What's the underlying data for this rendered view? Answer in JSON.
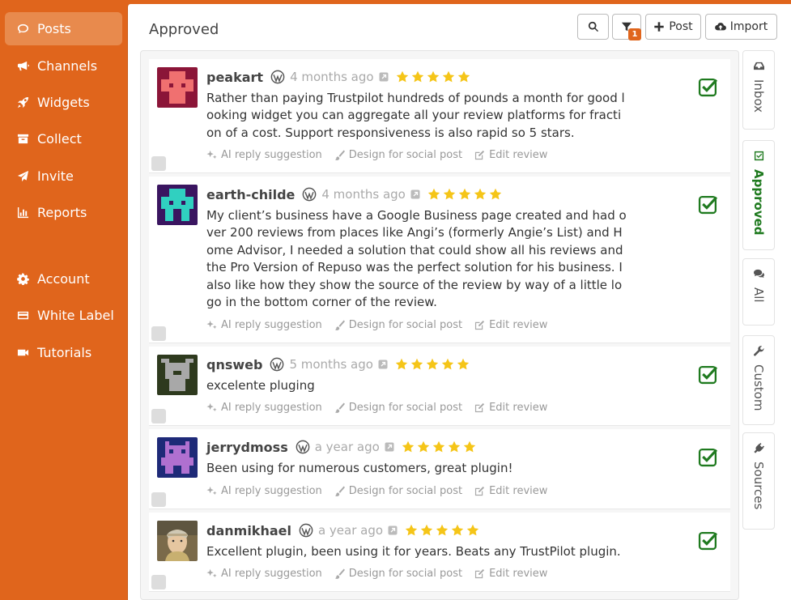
{
  "sidebar": {
    "items": [
      {
        "label": "Posts",
        "icon": "comment-icon",
        "active": true
      },
      {
        "label": "Channels",
        "icon": "megaphone-icon"
      },
      {
        "label": "Widgets",
        "icon": "rocket-icon"
      },
      {
        "label": "Collect",
        "icon": "archive-icon"
      },
      {
        "label": "Invite",
        "icon": "paper-plane-icon"
      },
      {
        "label": "Reports",
        "icon": "bar-chart-icon"
      },
      {
        "label": "Account",
        "icon": "gear-icon"
      },
      {
        "label": "White Label",
        "icon": "credit-card-icon"
      },
      {
        "label": "Tutorials",
        "icon": "video-icon"
      }
    ]
  },
  "header": {
    "title": "Approved",
    "filter_badge": "1",
    "post_label": "Post",
    "import_label": "Import"
  },
  "actions": {
    "ai": "AI reply suggestion",
    "design": "Design for social post",
    "edit": "Edit review"
  },
  "reviews": [
    {
      "author": "peakart",
      "time": "4 months ago",
      "rating": 5,
      "text": "Rather than paying Trustpilot hundreds of pounds a month for good looking widget you can aggregate all your review platforms for fraction of a cost. Support responsiveness is also rapid so 5 stars."
    },
    {
      "author": "earth-childe",
      "time": "4 months ago",
      "rating": 5,
      "text": "My client’s business have a Google Business page created and had over 200 reviews from places like Angi’s (formerly Angie’s List) and Home Advisor, I needed a solution that could show all his reviews and the Pro Version of Repuso was the perfect solution for his business. I also like how they show the source of the review by way of a little logo in the bottom corner of the review."
    },
    {
      "author": "qnsweb",
      "time": "5 months ago",
      "rating": 5,
      "text": "excelente pluging"
    },
    {
      "author": "jerrydmoss",
      "time": "a year ago",
      "rating": 5,
      "text": "Been using for numerous customers, great plugin!"
    },
    {
      "author": "danmikhael",
      "time": "a year ago",
      "rating": 5,
      "text": "Excellent plugin, been using it for years. Beats any TrustPilot plugin."
    }
  ],
  "right_tabs": [
    {
      "label": "Inbox",
      "icon": "inbox-icon"
    },
    {
      "label": "Approved",
      "icon": "check-square-icon",
      "active": true
    },
    {
      "label": "All",
      "icon": "comments-icon"
    },
    {
      "label": "Custom",
      "icon": "wrench-icon"
    },
    {
      "label": "Sources",
      "icon": "plug-icon"
    }
  ],
  "colors": {
    "brand": "#E0651C",
    "approved": "#1F7A1F",
    "star": "#F5C518"
  }
}
